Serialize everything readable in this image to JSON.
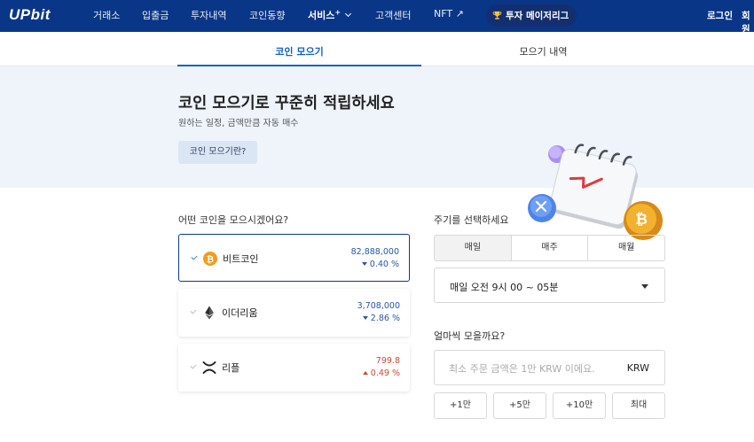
{
  "header": {
    "logo": "UPbit",
    "nav": [
      "거래소",
      "입출금",
      "투자내역",
      "코인동향",
      "서비스",
      "고객센터",
      "NFT ↗"
    ],
    "services_sup": "+",
    "promo": "투자 메이저리그",
    "login": "로그인",
    "signup": "회원"
  },
  "tabs": [
    "코인 모으기",
    "모으기 내역"
  ],
  "hero": {
    "title": "코인 모으기로 꾸준히 적립하세요",
    "subtitle": "원하는 일정, 금액만큼 자동 매수",
    "button": "코인 모으기란?"
  },
  "coin_section": {
    "label": "어떤 코인을 모으시겠어요?",
    "coins": [
      {
        "name": "비트코인",
        "price": "82,888,000",
        "change": "0.40 %",
        "direction": "down",
        "icon": "bitcoin-icon",
        "selected": true
      },
      {
        "name": "이더리움",
        "price": "3,708,000",
        "change": "2.86 %",
        "direction": "down",
        "icon": "ethereum-icon",
        "selected": false
      },
      {
        "name": "리플",
        "price": "799.8",
        "change": "0.49 %",
        "direction": "up",
        "icon": "ripple-icon",
        "selected": false
      }
    ]
  },
  "period_section": {
    "label": "주기를 선택하세요",
    "options": [
      "매일",
      "매주",
      "매월"
    ],
    "selected": "매일",
    "time": "매일 오전 9시 00 ~ 05분"
  },
  "amount_section": {
    "label": "얼마씩 모을까요?",
    "placeholder": "최소 주문 금액은 1만 KRW 이에요.",
    "unit": "KRW",
    "quick": [
      "+1만",
      "+5만",
      "+10만",
      "최대"
    ]
  },
  "colors": {
    "header_bg": "#093687",
    "accent": "#1261c4",
    "down": "#2b56a4",
    "up": "#c84a31",
    "hero_bg": "#eff4fb"
  }
}
